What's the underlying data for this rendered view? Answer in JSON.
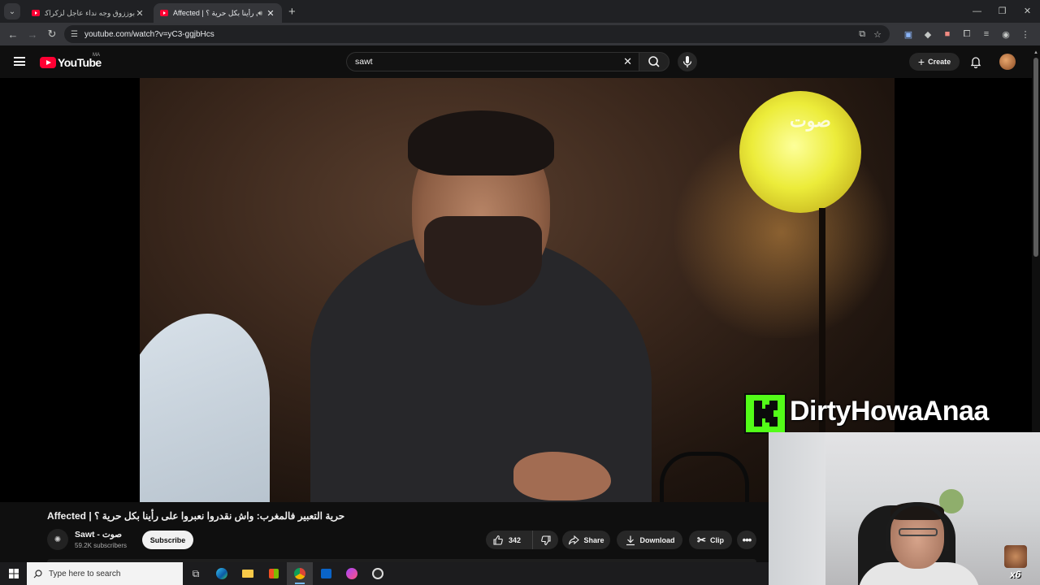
{
  "browser": {
    "tabs": [
      {
        "title": "بوززوق وجه نداء عاجل لزكراكي وة",
        "active": false
      },
      {
        "title": "Affected | حرية التعبير فالمغرب: واش نقدروا نعبروا على رأينا بكل حرية ؟",
        "active": true
      }
    ],
    "new_tab_label": "+",
    "url": "youtube.com/watch?v=yC3-ggjbHcs",
    "window_controls": {
      "minimize": "—",
      "maximize": "❐",
      "close": "✕"
    }
  },
  "youtube": {
    "logo_text": "YouTube",
    "country_code": "MA",
    "search_value": "sawt",
    "create_label": "Create"
  },
  "video": {
    "overlay_logo_text": "صوت",
    "title": "Affected | حرية التعبير فالمغرب: واش نقدروا نعبروا على رأينا بكل حرية ؟",
    "channel_name": "Sawt - صوت",
    "subscribers": "59.2K subscribers",
    "subscribe_label": "Subscribe",
    "like_count": "342",
    "share_label": "Share",
    "download_label": "Download",
    "clip_label": "Clip",
    "more_label": "•••"
  },
  "overlay": {
    "streamer_name": "DirtyHowaAnaa",
    "emote_count": "x6"
  },
  "taskbar": {
    "search_placeholder": "Type here to search"
  },
  "colors": {
    "youtube_red": "#ff0033",
    "kick_green": "#53fc18",
    "background": "#0f0f0f"
  }
}
